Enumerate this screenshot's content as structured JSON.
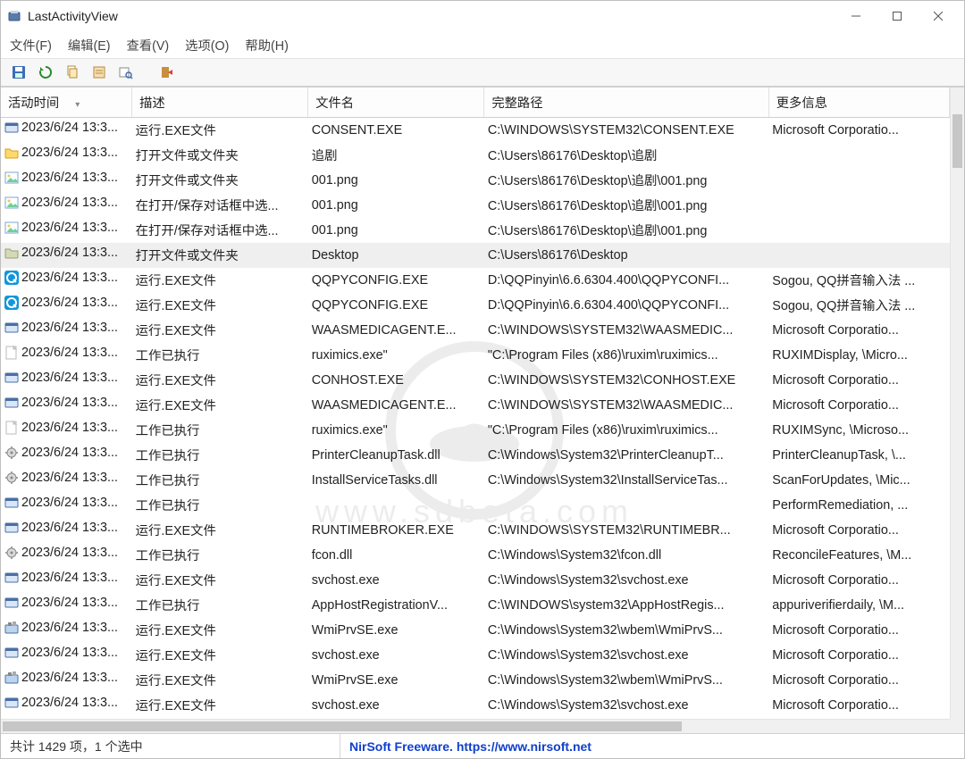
{
  "app": {
    "title": "LastActivityView"
  },
  "menu": {
    "file": "文件(F)",
    "edit": "编辑(E)",
    "view": "查看(V)",
    "options": "选项(O)",
    "help": "帮助(H)"
  },
  "toolbar": {
    "save": "save",
    "refresh": "refresh",
    "copy": "copy",
    "properties": "properties",
    "find": "find",
    "exit": "exit"
  },
  "columns": {
    "c0": "活动时间",
    "c1": "描述",
    "c2": "文件名",
    "c3": "完整路径",
    "c4": "更多信息"
  },
  "rows": [
    {
      "icon": "exe",
      "time": "2023/6/24 13:3...",
      "desc": "运行.EXE文件",
      "file": "CONSENT.EXE",
      "path": "C:\\WINDOWS\\SYSTEM32\\CONSENT.EXE",
      "more": "Microsoft Corporatio..."
    },
    {
      "icon": "folder",
      "time": "2023/6/24 13:3...",
      "desc": "打开文件或文件夹",
      "file": "追剧",
      "path": "C:\\Users\\86176\\Desktop\\追剧",
      "more": ""
    },
    {
      "icon": "img",
      "time": "2023/6/24 13:3...",
      "desc": "打开文件或文件夹",
      "file": "001.png",
      "path": "C:\\Users\\86176\\Desktop\\追剧\\001.png",
      "more": ""
    },
    {
      "icon": "img",
      "time": "2023/6/24 13:3...",
      "desc": "在打开/保存对话框中选...",
      "file": "001.png",
      "path": "C:\\Users\\86176\\Desktop\\追剧\\001.png",
      "more": ""
    },
    {
      "icon": "img",
      "time": "2023/6/24 13:3...",
      "desc": "在打开/保存对话框中选...",
      "file": "001.png",
      "path": "C:\\Users\\86176\\Desktop\\追剧\\001.png",
      "more": ""
    },
    {
      "icon": "dfolder",
      "time": "2023/6/24 13:3...",
      "desc": "打开文件或文件夹",
      "file": "Desktop",
      "path": "C:\\Users\\86176\\Desktop",
      "more": "",
      "selected": true
    },
    {
      "icon": "qq",
      "time": "2023/6/24 13:3...",
      "desc": "运行.EXE文件",
      "file": "QQPYCONFIG.EXE",
      "path": "D:\\QQPinyin\\6.6.6304.400\\QQPYCONFI...",
      "more": "Sogou, QQ拼音输入法 ..."
    },
    {
      "icon": "qq",
      "time": "2023/6/24 13:3...",
      "desc": "运行.EXE文件",
      "file": "QQPYCONFIG.EXE",
      "path": "D:\\QQPinyin\\6.6.6304.400\\QQPYCONFI...",
      "more": "Sogou, QQ拼音输入法 ..."
    },
    {
      "icon": "exe",
      "time": "2023/6/24 13:3...",
      "desc": "运行.EXE文件",
      "file": "WAASMEDICAGENT.E...",
      "path": "C:\\WINDOWS\\SYSTEM32\\WAASMEDIC...",
      "more": "Microsoft Corporatio..."
    },
    {
      "icon": "blank",
      "time": "2023/6/24 13:3...",
      "desc": "工作已执行",
      "file": "ruximics.exe\"",
      "path": "\"C:\\Program Files (x86)\\ruxim\\ruximics...",
      "more": "RUXIMDisplay, \\Micro..."
    },
    {
      "icon": "exe",
      "time": "2023/6/24 13:3...",
      "desc": "运行.EXE文件",
      "file": "CONHOST.EXE",
      "path": "C:\\WINDOWS\\SYSTEM32\\CONHOST.EXE",
      "more": "Microsoft Corporatio..."
    },
    {
      "icon": "exe",
      "time": "2023/6/24 13:3...",
      "desc": "运行.EXE文件",
      "file": "WAASMEDICAGENT.E...",
      "path": "C:\\WINDOWS\\SYSTEM32\\WAASMEDIC...",
      "more": "Microsoft Corporatio..."
    },
    {
      "icon": "blank",
      "time": "2023/6/24 13:3...",
      "desc": "工作已执行",
      "file": "ruximics.exe\"",
      "path": "\"C:\\Program Files (x86)\\ruxim\\ruximics...",
      "more": "RUXIMSync, \\Microso..."
    },
    {
      "icon": "gear",
      "time": "2023/6/24 13:3...",
      "desc": "工作已执行",
      "file": "PrinterCleanupTask.dll",
      "path": "C:\\Windows\\System32\\PrinterCleanupT...",
      "more": "PrinterCleanupTask, \\..."
    },
    {
      "icon": "gear",
      "time": "2023/6/24 13:3...",
      "desc": "工作已执行",
      "file": "InstallServiceTasks.dll",
      "path": "C:\\Windows\\System32\\InstallServiceTas...",
      "more": "ScanForUpdates, \\Mic..."
    },
    {
      "icon": "exe",
      "time": "2023/6/24 13:3...",
      "desc": "工作已执行",
      "file": "",
      "path": "",
      "more": "PerformRemediation, ..."
    },
    {
      "icon": "exe",
      "time": "2023/6/24 13:3...",
      "desc": "运行.EXE文件",
      "file": "RUNTIMEBROKER.EXE",
      "path": "C:\\WINDOWS\\SYSTEM32\\RUNTIMEBR...",
      "more": "Microsoft Corporatio..."
    },
    {
      "icon": "gear",
      "time": "2023/6/24 13:3...",
      "desc": "工作已执行",
      "file": "fcon.dll",
      "path": "C:\\Windows\\System32\\fcon.dll",
      "more": "ReconcileFeatures, \\M..."
    },
    {
      "icon": "exe",
      "time": "2023/6/24 13:3...",
      "desc": "运行.EXE文件",
      "file": "svchost.exe",
      "path": "C:\\Windows\\System32\\svchost.exe",
      "more": "Microsoft Corporatio..."
    },
    {
      "icon": "exe",
      "time": "2023/6/24 13:3...",
      "desc": "工作已执行",
      "file": "AppHostRegistrationV...",
      "path": "C:\\WINDOWS\\system32\\AppHostRegis...",
      "more": "appuriverifierdaily, \\M..."
    },
    {
      "icon": "wmi",
      "time": "2023/6/24 13:3...",
      "desc": "运行.EXE文件",
      "file": "WmiPrvSE.exe",
      "path": "C:\\Windows\\System32\\wbem\\WmiPrvS...",
      "more": "Microsoft Corporatio..."
    },
    {
      "icon": "exe",
      "time": "2023/6/24 13:3...",
      "desc": "运行.EXE文件",
      "file": "svchost.exe",
      "path": "C:\\Windows\\System32\\svchost.exe",
      "more": "Microsoft Corporatio..."
    },
    {
      "icon": "wmi",
      "time": "2023/6/24 13:3...",
      "desc": "运行.EXE文件",
      "file": "WmiPrvSE.exe",
      "path": "C:\\Windows\\System32\\wbem\\WmiPrvS...",
      "more": "Microsoft Corporatio..."
    },
    {
      "icon": "exe",
      "time": "2023/6/24 13:3...",
      "desc": "运行.EXE文件",
      "file": "svchost.exe",
      "path": "C:\\Windows\\System32\\svchost.exe",
      "more": "Microsoft Corporatio..."
    }
  ],
  "status": {
    "count": "共计 1429 项，1 个选中",
    "freeware": "NirSoft Freeware. https://www.nirsoft.net"
  }
}
